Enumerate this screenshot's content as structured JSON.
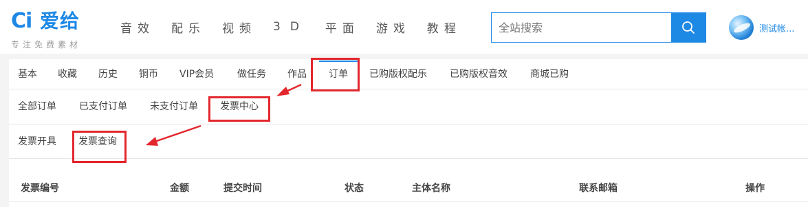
{
  "header": {
    "logo_mark": "Ci",
    "logo_name": "爱给",
    "slogan": "专注免费素材",
    "nav": [
      "音效",
      "配乐",
      "视频",
      "3D",
      "平面",
      "游戏",
      "教程"
    ],
    "search": {
      "placeholder": "全站搜索",
      "value": ""
    },
    "user": {
      "name": "测试帐..."
    }
  },
  "tabs_level1": {
    "items": [
      "基本",
      "收藏",
      "历史",
      "铜币",
      "VIP会员",
      "做任务",
      "作品",
      "订单",
      "已购版权配乐",
      "已购版权音效",
      "商城已购"
    ],
    "active": "订单"
  },
  "tabs_level2": {
    "items": [
      "全部订单",
      "已支付订单",
      "未支付订单",
      "发票中心"
    ],
    "active": "发票中心"
  },
  "tabs_level3": {
    "items": [
      "发票开具",
      "发票查询"
    ],
    "active": "发票查询"
  },
  "table": {
    "columns": [
      "发票编号",
      "金额",
      "提交时间",
      "状态",
      "主体名称",
      "联系邮箱",
      "操作"
    ],
    "rows": []
  },
  "colors": {
    "accent": "#1e88e5",
    "annotation": "#e3272d",
    "background": "#f4f4f4"
  }
}
